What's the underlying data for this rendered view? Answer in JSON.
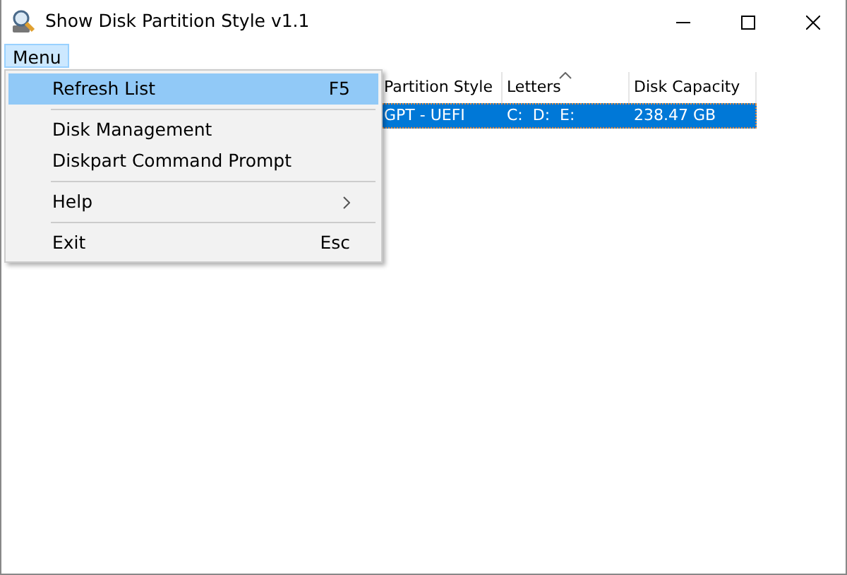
{
  "window": {
    "title": "Show Disk Partition Style v1.1"
  },
  "menubar": [
    {
      "label": "Menu",
      "open": true
    }
  ],
  "menu": [
    {
      "kind": "item",
      "label": "Refresh List",
      "shortcut": "F5",
      "selected": true,
      "submenu": false
    },
    {
      "kind": "separator"
    },
    {
      "kind": "item",
      "label": "Disk Management",
      "selected": false,
      "submenu": false
    },
    {
      "kind": "item",
      "label": "Diskpart Command Prompt",
      "selected": false,
      "submenu": false
    },
    {
      "kind": "separator"
    },
    {
      "kind": "item",
      "label": "Help",
      "selected": false,
      "submenu": true
    },
    {
      "kind": "separator"
    },
    {
      "kind": "item",
      "label": "Exit",
      "shortcut": "Esc",
      "selected": false,
      "submenu": false
    }
  ],
  "table": {
    "columns": [
      {
        "label": "Partition Style",
        "sorted": false
      },
      {
        "label": "Letters",
        "sorted": true
      },
      {
        "label": "Disk Capacity",
        "sorted": false
      }
    ],
    "rows": [
      {
        "cells": [
          "GPT - UEFI",
          "C:  D:  E:",
          "238.47 GB"
        ],
        "selected": true
      }
    ]
  }
}
